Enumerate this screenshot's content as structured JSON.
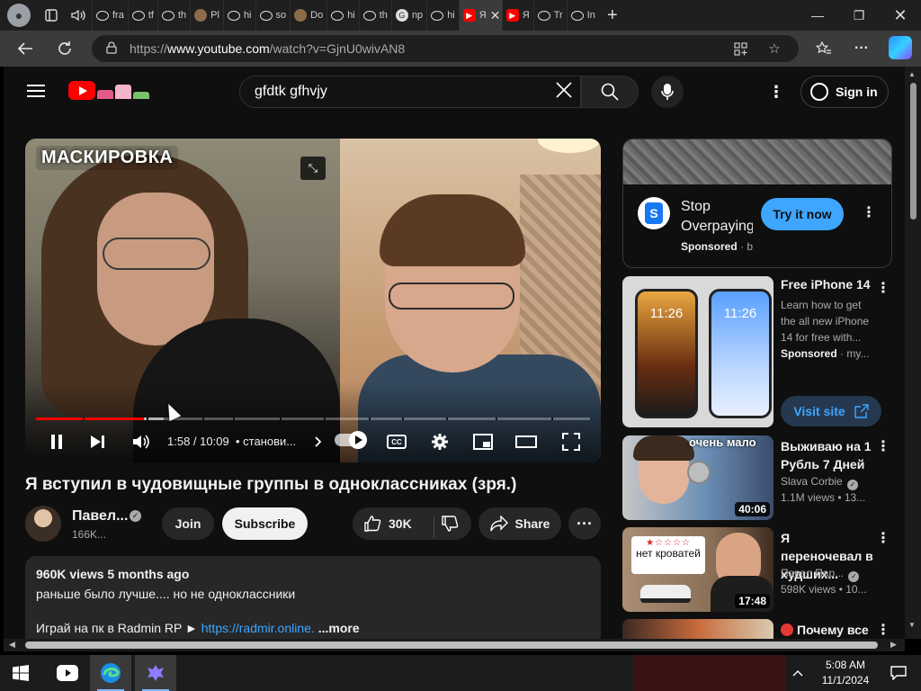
{
  "browser": {
    "tabs": [
      {
        "label": "fra",
        "icon": "search-icon"
      },
      {
        "label": "tf",
        "icon": "search-icon"
      },
      {
        "label": "th",
        "icon": "search-icon"
      },
      {
        "label": "Pl",
        "icon": "site-icon"
      },
      {
        "label": "hi",
        "icon": "search-icon"
      },
      {
        "label": "so",
        "icon": "search-icon"
      },
      {
        "label": "Do",
        "icon": "site-icon"
      },
      {
        "label": "hi",
        "icon": "search-icon"
      },
      {
        "label": "th",
        "icon": "search-icon"
      },
      {
        "label": "np",
        "icon": "google-icon"
      },
      {
        "label": "hi",
        "icon": "search-icon"
      },
      {
        "label": "Я",
        "icon": "youtube-icon"
      },
      {
        "label": "Я",
        "icon": "youtube-icon"
      },
      {
        "label": "Tr",
        "icon": "search-icon"
      },
      {
        "label": "In",
        "icon": "search-icon"
      }
    ],
    "url_prefix": "https://",
    "url_host": "www.youtube.com",
    "url_path": "/watch?v=GjnU0wivAN8"
  },
  "youtube": {
    "search_value": "gfdtk gfhvjy",
    "signin_label": "Sign in",
    "accent": "#ff0000",
    "link_color": "#3ea6ff"
  },
  "video": {
    "watermark": "МАСКИРОВКА",
    "time": "1:58 / 10:09",
    "chapter": "• станови...",
    "cc_label": "CC",
    "played_fraction": 0.195,
    "loaded_fraction": 0.23,
    "chapter_marks": [
      0.085,
      0.2,
      0.3,
      0.355,
      0.44,
      0.52,
      0.6,
      0.66,
      0.74,
      0.83,
      0.93
    ]
  },
  "watch": {
    "title": "Я вступил в чудовищные группы в одноклассниках (зря.)",
    "channel_name": "Павел...",
    "channel_subs": "166K...",
    "join_label": "Join",
    "subscribe_label": "Subscribe",
    "likes": "30K",
    "share_label": "Share",
    "description": {
      "stats": "960K views  5 months ago",
      "line1": "раньше было лучше.... но не одноклассники",
      "line2_prefix": "Играй на пк в Radmin RP ► ",
      "line2_link": "https://radmir.online.",
      "more": "...more"
    }
  },
  "sidebar": {
    "ad": {
      "title": "Stop Overpaying",
      "sponsored": "Sponsored",
      "sponsor_rest": " · b",
      "cta": "Try it now"
    },
    "promo": {
      "title": "Free iPhone 14",
      "desc": "Learn how to get the all new iPhone 14 for free with...",
      "sponsored": "Sponsored",
      "sponsor_rest": " · my...",
      "phone_time_1": "11:26",
      "phone_time_2": "11:26",
      "cta": "Visit site"
    },
    "recs": [
      {
        "title": "Выживаю на 1 Рубль 7 Дней",
        "channel": "Slava Corbie",
        "meta": "1.1M views • 13...",
        "duration": "40:06",
        "thumb_text": "очень мало"
      },
      {
        "title": "Я переночевал в худших...",
        "channel": "Павел Пар...",
        "meta": "598K views • 10...",
        "duration": "17:48",
        "thumb_text": "нет кроватей"
      },
      {
        "title": "Почему все",
        "channel": "",
        "meta": "",
        "duration": "",
        "thumb_text": ""
      }
    ]
  },
  "taskbar": {
    "time": "5:08 AM",
    "date": "11/1/2024"
  }
}
